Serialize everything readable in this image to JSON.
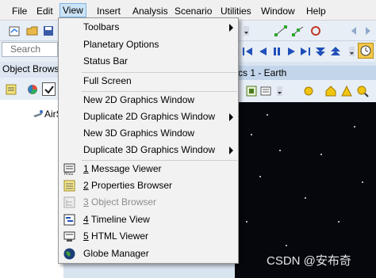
{
  "menubar": {
    "items": [
      "File",
      "Edit",
      "View",
      "Insert",
      "Analysis",
      "Scenario",
      "Utilities",
      "Window",
      "Help"
    ],
    "active": "View"
  },
  "search": {
    "placeholder": "Search"
  },
  "object_browser": {
    "title": "Object Brows",
    "tree_item": "AirS"
  },
  "graphics_window": {
    "title": "cs 1 - Earth"
  },
  "view_menu": {
    "items": [
      {
        "label": "Toolbars",
        "submenu": true
      },
      {
        "label": "Planetary Options"
      },
      {
        "label": "Status Bar"
      },
      {
        "label": "Full Screen"
      },
      {
        "label": "New 2D Graphics Window"
      },
      {
        "label": "Duplicate 2D Graphics Window",
        "submenu": true
      },
      {
        "label": "New 3D Graphics Window"
      },
      {
        "label": "Duplicate 3D Graphics Window",
        "submenu": true
      },
      {
        "prefix": "1",
        "label": " Message Viewer",
        "icon": "message-viewer-icon"
      },
      {
        "prefix": "2",
        "label": " Properties Browser",
        "icon": "properties-browser-icon"
      },
      {
        "prefix": "3",
        "label": " Object Browser",
        "icon": "object-browser-icon",
        "disabled": true
      },
      {
        "prefix": "4",
        "label": " Timeline View",
        "icon": "timeline-view-icon"
      },
      {
        "prefix": "5",
        "label": " HTML Viewer",
        "icon": "html-viewer-icon"
      },
      {
        "label": "Globe Manager",
        "icon": "globe-manager-icon"
      }
    ]
  },
  "watermark": "CSDN @安布奇"
}
